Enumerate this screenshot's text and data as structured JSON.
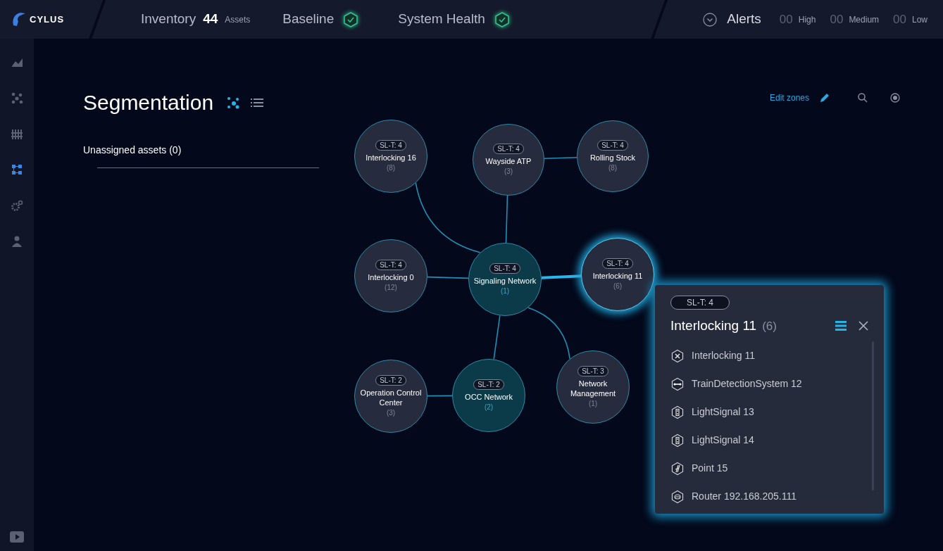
{
  "topbar": {
    "logo": "CYLUS",
    "inventory": {
      "label": "Inventory",
      "count": "44",
      "unit": "Assets"
    },
    "baseline": {
      "label": "Baseline",
      "ok": true
    },
    "system_health": {
      "label": "System Health",
      "ok": true
    },
    "alerts": {
      "label": "Alerts",
      "levels": [
        {
          "count": "00",
          "label": "High"
        },
        {
          "count": "00",
          "label": "Medium"
        },
        {
          "count": "00",
          "label": "Low"
        }
      ]
    }
  },
  "sidebar": {
    "items": [
      {
        "selected": false
      },
      {
        "selected": false
      },
      {
        "selected": false
      },
      {
        "selected": true
      },
      {
        "selected": false
      },
      {
        "selected": false
      }
    ]
  },
  "page": {
    "title": "Segmentation",
    "views": [
      {
        "selected": true
      },
      {
        "selected": false
      }
    ],
    "edit_zones": "Edit zones",
    "unassigned": "Unassigned assets (0)"
  },
  "zones": [
    {
      "level": "SL-T: 4",
      "name": "Interlocking 16",
      "count": "(8)",
      "kind": "zone",
      "selected": false
    },
    {
      "level": "SL-T: 4",
      "name": "Wayside ATP",
      "count": "(3)",
      "kind": "zone",
      "selected": false
    },
    {
      "level": "SL-T: 4",
      "name": "Rolling Stock",
      "count": "(8)",
      "kind": "zone",
      "selected": false
    },
    {
      "level": "SL-T: 4",
      "name": "Interlocking 0",
      "count": "(12)",
      "kind": "zone",
      "selected": false
    },
    {
      "level": "SL-T: 4",
      "name": "Signaling Network",
      "count": "(1)",
      "kind": "network",
      "selected": false
    },
    {
      "level": "SL-T: 4",
      "name": "Interlocking 11",
      "count": "(6)",
      "kind": "zone",
      "selected": true
    },
    {
      "level": "SL-T: 2",
      "name": "Operation Control Center",
      "count": "(3)",
      "kind": "zone",
      "selected": false
    },
    {
      "level": "SL-T: 2",
      "name": "OCC Network",
      "count": "(2)",
      "kind": "network",
      "selected": false
    },
    {
      "level": "SL-T: 3",
      "name": "Network Management",
      "count": "(1)",
      "kind": "zone",
      "selected": false
    }
  ],
  "panel": {
    "level": "SL-T: 4",
    "title": "Interlocking 11",
    "count": "(6)",
    "assets": [
      {
        "kind": "interlocking",
        "name": "Interlocking 11"
      },
      {
        "kind": "detection",
        "name": "TrainDetectionSystem 12"
      },
      {
        "kind": "signal",
        "name": "LightSignal 13"
      },
      {
        "kind": "signal",
        "name": "LightSignal 14"
      },
      {
        "kind": "point",
        "name": "Point 15"
      },
      {
        "kind": "router",
        "name": "Router 192.168.205.111"
      }
    ]
  }
}
